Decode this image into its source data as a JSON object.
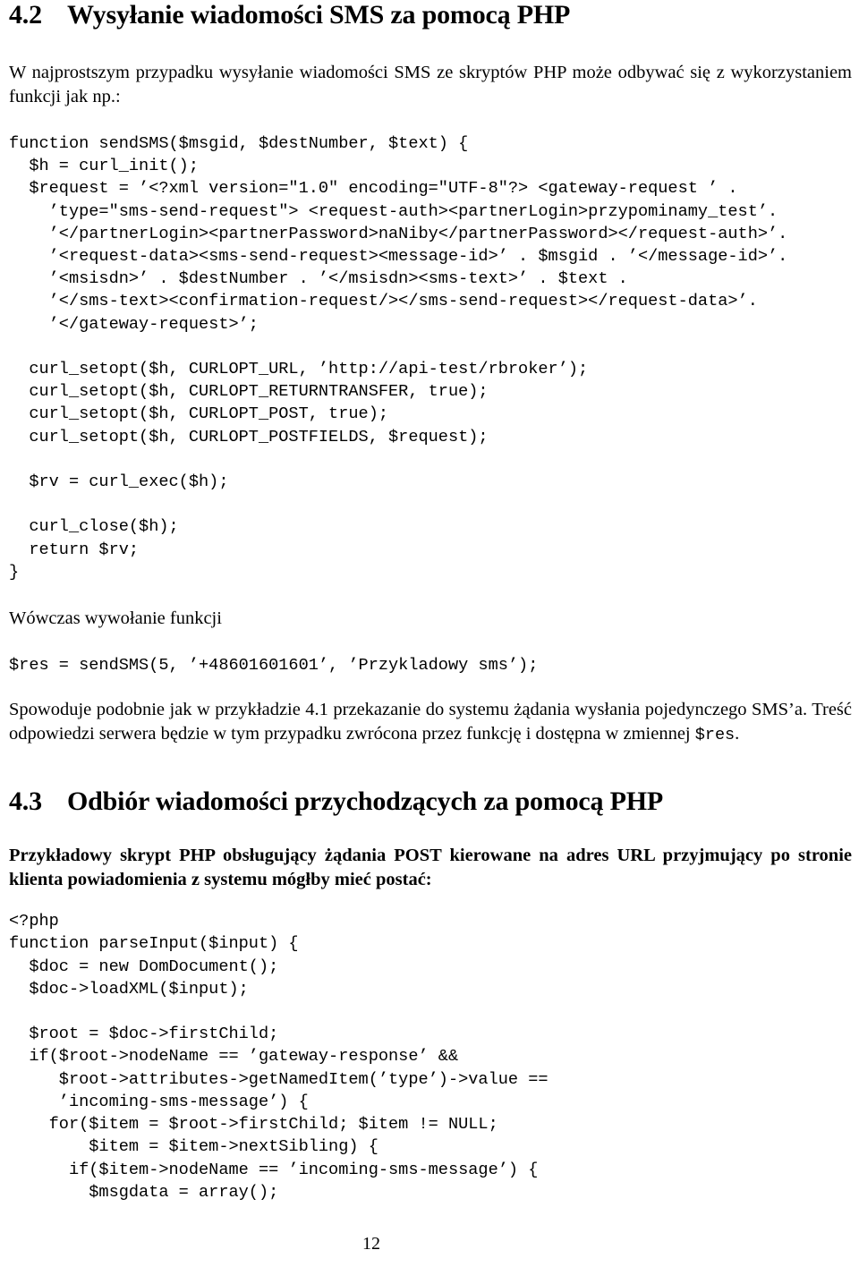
{
  "document": {
    "language": "pl",
    "page_number": "12",
    "text_color": "#000000",
    "background_color": "#ffffff"
  },
  "sections": {
    "s42": {
      "number": "4.2",
      "title": "Wysyłanie wiadomości SMS za pomocą PHP",
      "intro_paragraph": "W najprostszym przypadku wysyłanie wiadomości SMS ze skryptów PHP może odbywać się z wykorzystaniem funkcji jak np.:",
      "code_sendsms": "function sendSMS($msgid, $destNumber, $text) {\n  $h = curl_init();\n  $request = ’<?xml version=\"1.0\" encoding=\"UTF-8\"?> <gateway-request ’ .\n    ’type=\"sms-send-request\"> <request-auth><partnerLogin>przypominamy_test’.\n    ’</partnerLogin><partnerPassword>naNiby</partnerPassword></request-auth>’.\n    ’<request-data><sms-send-request><message-id>’ . $msgid . ’</message-id>’.\n    ’<msisdn>’ . $destNumber . ’</msisdn><sms-text>’ . $text .\n    ’</sms-text><confirmation-request/></sms-send-request></request-data>’.\n    ’</gateway-request>’;\n\n  curl_setopt($h, CURLOPT_URL, ’http://api-test/rbroker’);\n  curl_setopt($h, CURLOPT_RETURNTRANSFER, true);\n  curl_setopt($h, CURLOPT_POST, true);\n  curl_setopt($h, CURLOPT_POSTFIELDS, $request);\n\n  $rv = curl_exec($h);\n\n  curl_close($h);\n  return $rv;\n}",
      "call_intro": "Wówczas wywołanie funkcji",
      "code_call": "$res = sendSMS(5, ’+48601601601’, ’Przykladowy sms’);",
      "after_call_paragraph_part1": "Spowoduje podobnie jak w przykładzie 4.1 przekazanie do systemu żądania wysłania pojedynczego SMS’a. Treść odpowiedzi serwera będzie w tym przypadku zwrócona przez funkcję i dostępna w zmiennej ",
      "after_call_paragraph_mono": "$res",
      "after_call_paragraph_part2": "."
    },
    "s43": {
      "number": "4.3",
      "title": "Odbiór wiadomości przychodzących za pomocą PHP",
      "intro_paragraph": "Przykładowy skrypt PHP obsługujący żądania POST kierowane na adres URL przyjmujący po stronie klienta powiadomienia z systemu mógłby mieć postać:",
      "code_parseinput": "<?php\nfunction parseInput($input) {\n  $doc = new DomDocument();\n  $doc->loadXML($input);\n\n  $root = $doc->firstChild;\n  if($root->nodeName == ’gateway-response’ &&\n     $root->attributes->getNamedItem(’type’)->value ==\n     ’incoming-sms-message’) {\n    for($item = $root->firstChild; $item != NULL;\n        $item = $item->nextSibling) {\n      if($item->nodeName == ’incoming-sms-message’) {\n        $msgdata = array();"
    }
  }
}
